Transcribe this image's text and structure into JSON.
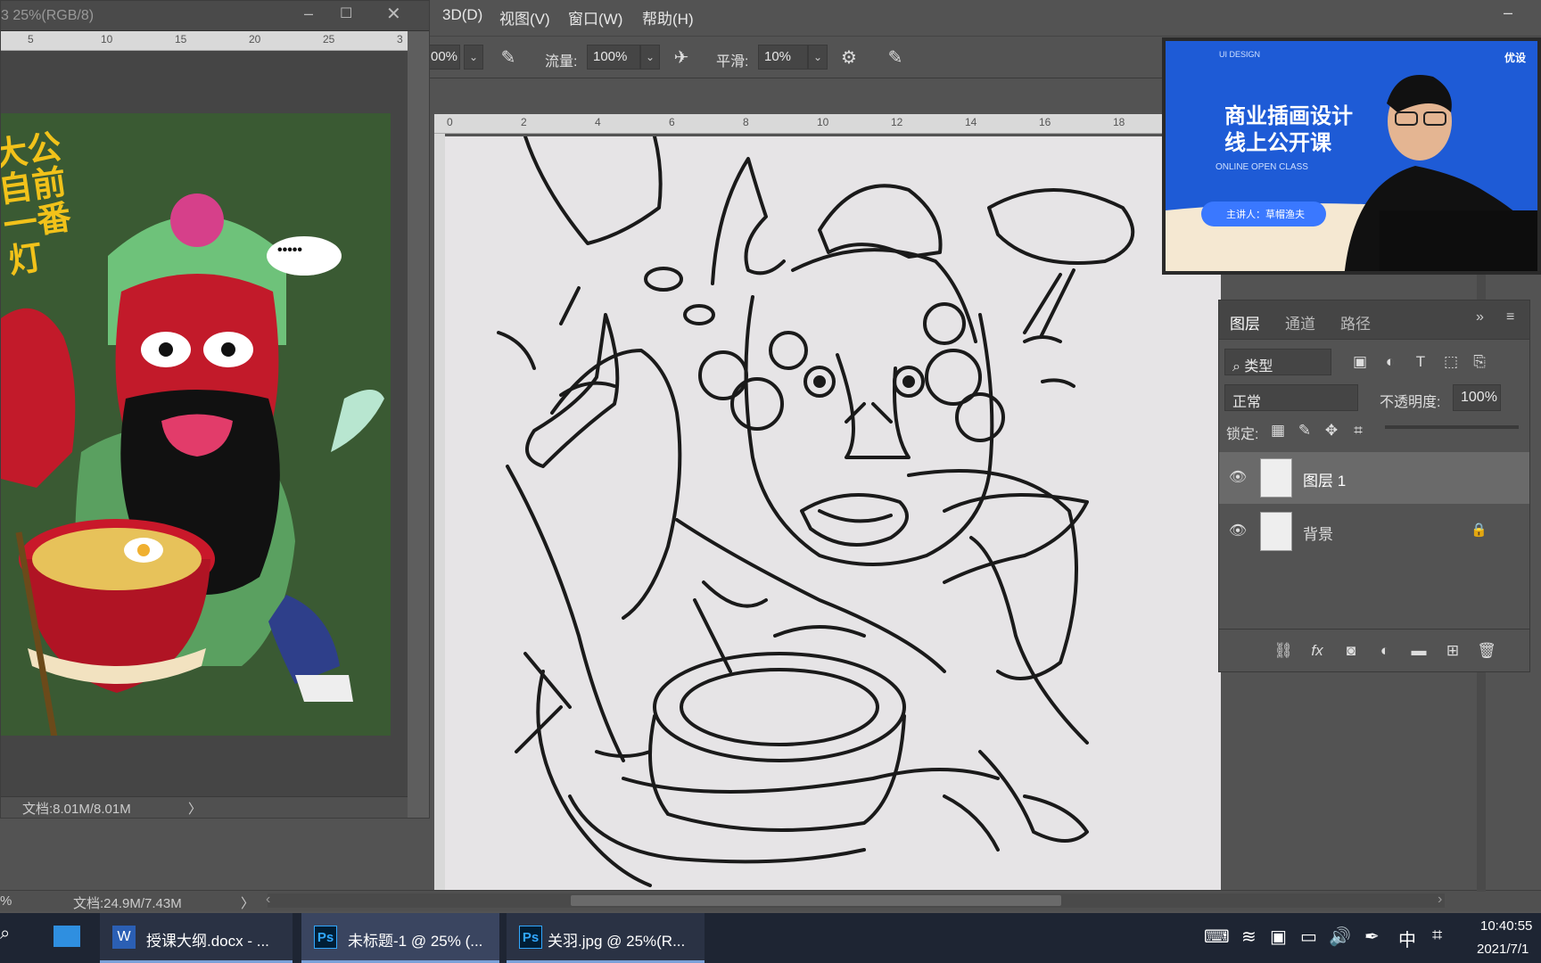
{
  "menubar": {
    "items": [
      "3D(D)",
      "视图(V)",
      "窗口(W)",
      "帮助(H)"
    ]
  },
  "options_bar": {
    "opacity_partial": "00%",
    "flow_label": "流量:",
    "flow_value": "100%",
    "smooth_label": "平滑:",
    "smooth_value": "10%"
  },
  "doc_window": {
    "title": "3 25%(RGB/8)",
    "ruler_ticks": [
      "5",
      "10",
      "15",
      "20",
      "25",
      "3"
    ],
    "status": "文档:8.01M/8.01M",
    "status_arrow": "〉"
  },
  "artwork": {
    "calligraphy": "大公自前一番灯",
    "speech_bubble": "•••••"
  },
  "main_ruler": {
    "ticks": [
      "0",
      "2",
      "4",
      "6",
      "8",
      "10",
      "12",
      "14",
      "16",
      "18"
    ]
  },
  "main_status": {
    "zoom_partial": "%",
    "doc": "文档:24.9M/7.43M",
    "arrow": "〉",
    "left_arrow": "‹",
    "right_arrow": "›"
  },
  "video": {
    "brand_small": "UI DESIGN",
    "title_line1": "商业插画设计",
    "title_line2": "线上公开课",
    "subtitle": "ONLINE OPEN CLASS",
    "speaker": "主讲人：草帽渔夫",
    "logo": "优设"
  },
  "layers_panel": {
    "tabs": [
      "图层",
      "通道",
      "路径"
    ],
    "filter_label": "类型",
    "blend_mode": "正常",
    "opacity_label": "不透明度:",
    "opacity_value": "100%",
    "lock_label": "锁定:",
    "layers": [
      {
        "name": "图层 1"
      },
      {
        "name": "背景"
      }
    ],
    "footer_fx": "fx"
  },
  "taskbar": {
    "items": [
      {
        "label": "授课大纲.docx - ...",
        "icon": "word-icon"
      },
      {
        "label": "未标题-1 @ 25% (...",
        "icon": "photoshop-icon"
      },
      {
        "label": "关羽.jpg @ 25%(R...",
        "icon": "photoshop-icon"
      }
    ],
    "ime_char": "中",
    "time": "10:40:55",
    "date": "2021/7/1"
  },
  "colors": {
    "ps_bg": "#535353",
    "taskbar": "#1e2533",
    "video_blue": "#1e5bd6",
    "artwork_green": "#3a5a33",
    "canvas": "#e6e4e6"
  }
}
